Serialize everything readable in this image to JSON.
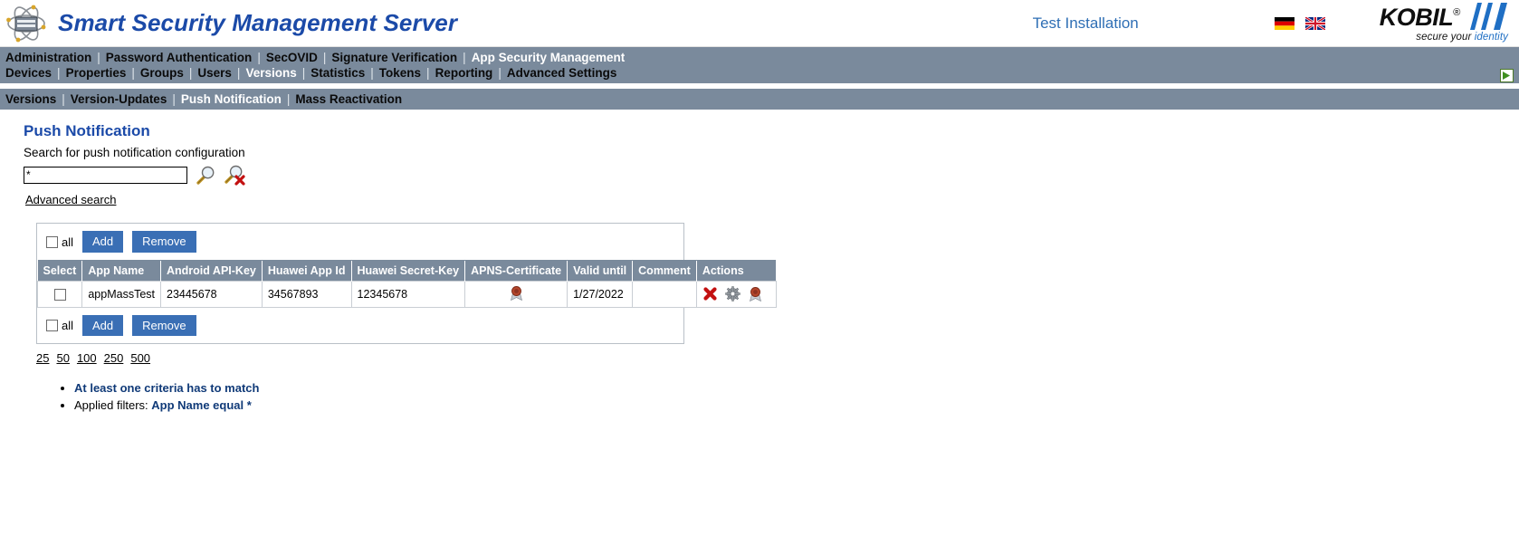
{
  "header": {
    "logo_icon": "atom-server-icon",
    "app_title": "Smart Security Management Server",
    "installation_label": "Test Installation",
    "flags": [
      {
        "name": "flag-de-icon",
        "title": "Deutsch"
      },
      {
        "name": "flag-en-icon",
        "title": "English"
      }
    ],
    "vendor": {
      "name": "KOBIL",
      "registered_mark": "®",
      "tagline_part1": "secure your",
      "tagline_part2": "identity"
    }
  },
  "nav_primary": {
    "items": [
      {
        "label": "Administration",
        "active": false
      },
      {
        "label": "Password Authentication",
        "active": false
      },
      {
        "label": "SecOVID",
        "active": false
      },
      {
        "label": "Signature Verification",
        "active": false
      },
      {
        "label": "App Security Management",
        "active": true
      }
    ],
    "separator": "|"
  },
  "nav_secondary": {
    "items": [
      {
        "label": "Devices",
        "active": false
      },
      {
        "label": "Properties",
        "active": false
      },
      {
        "label": "Groups",
        "active": false
      },
      {
        "label": "Users",
        "active": false
      },
      {
        "label": "Versions",
        "active": true
      },
      {
        "label": "Statistics",
        "active": false
      },
      {
        "label": "Tokens",
        "active": false
      },
      {
        "label": "Reporting",
        "active": false
      },
      {
        "label": "Advanced Settings",
        "active": false
      }
    ],
    "separator": "|",
    "right_icon": "logout-icon"
  },
  "nav_tertiary": {
    "items": [
      {
        "label": "Versions",
        "active": false
      },
      {
        "label": "Version-Updates",
        "active": false
      },
      {
        "label": "Push Notification",
        "active": true
      },
      {
        "label": "Mass Reactivation",
        "active": false
      }
    ],
    "separator": "|"
  },
  "page": {
    "title": "Push Notification",
    "search_label": "Search for push notification configuration",
    "search_value": "*",
    "search_placeholder": "",
    "search_icon": "magnifier-icon",
    "clear_search_icon": "magnifier-clear-icon",
    "advanced_search_label": "Advanced search"
  },
  "toolbar": {
    "select_all_label": "all",
    "select_all_checked": false,
    "add_label": "Add",
    "remove_label": "Remove"
  },
  "table": {
    "columns": [
      "Select",
      "App Name",
      "Android API-Key",
      "Huawei App Id",
      "Huawei Secret-Key",
      "APNS-Certificate",
      "Valid until",
      "Comment",
      "Actions"
    ],
    "rows": [
      {
        "selected": false,
        "app_name": "appMassTest",
        "android_api_key": "23445678",
        "huawei_app_id": "34567893",
        "huawei_secret_key": "12345678",
        "apns_certificate_icon": "certificate-seal-icon",
        "valid_until": "1/27/2022",
        "comment": "",
        "actions": [
          {
            "name": "delete-icon",
            "title": "Delete"
          },
          {
            "name": "settings-gear-icon",
            "title": "Settings"
          },
          {
            "name": "certificate-seal-icon",
            "title": "Certificate"
          }
        ]
      }
    ]
  },
  "pagination": {
    "page_sizes": [
      "25",
      "50",
      "100",
      "250",
      "500"
    ]
  },
  "messages": [
    {
      "text": "At least one criteria has to match",
      "style": "strong"
    },
    {
      "prefix": "Applied filters: ",
      "text": "App Name equal *",
      "style": "prefixed"
    }
  ],
  "colors": {
    "brand_blue": "#1b4aa8",
    "nav_background": "#7a8a9c",
    "button_blue": "#3a6fb5",
    "link_blue": "#2f6fb5",
    "message_blue": "#103a78"
  }
}
